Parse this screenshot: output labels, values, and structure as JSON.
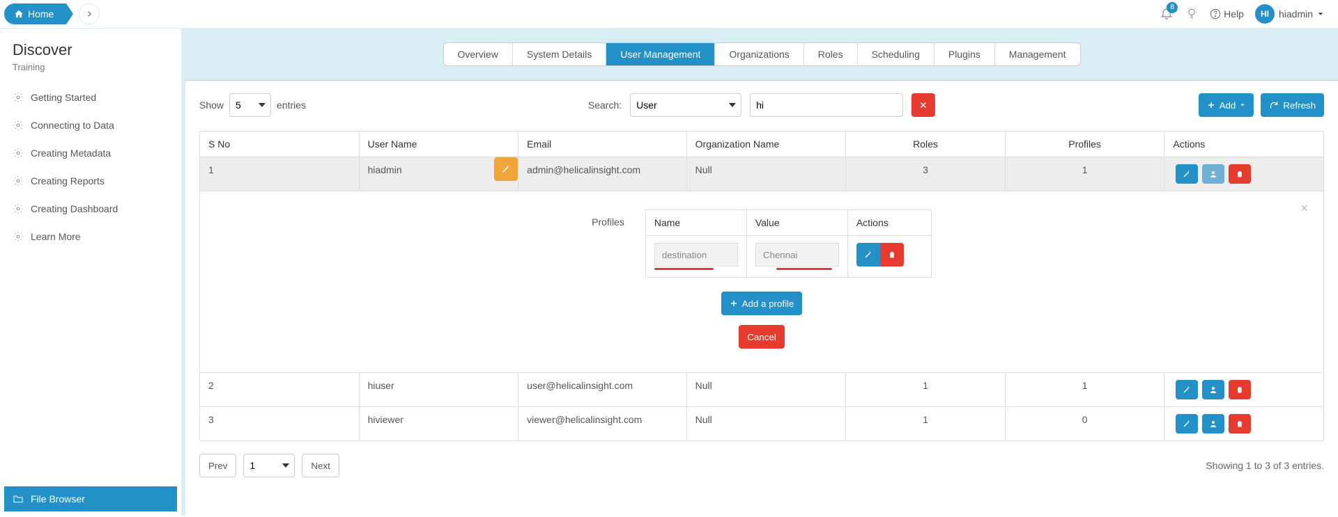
{
  "breadcrumb": {
    "home_label": "Home"
  },
  "topbar": {
    "notification_count": "8",
    "help_label": "Help",
    "user_initials": "HI",
    "user_name": "hiadmin"
  },
  "sidebar": {
    "title": "Discover",
    "subtitle": "Training",
    "items": [
      {
        "label": "Getting Started"
      },
      {
        "label": "Connecting to Data"
      },
      {
        "label": "Creating Metadata"
      },
      {
        "label": "Creating Reports"
      },
      {
        "label": "Creating Dashboard"
      },
      {
        "label": "Learn More"
      }
    ],
    "file_browser_label": "File Browser"
  },
  "tabs": [
    {
      "label": "Overview"
    },
    {
      "label": "System Details"
    },
    {
      "label": "User Management",
      "active": true
    },
    {
      "label": "Organizations"
    },
    {
      "label": "Roles"
    },
    {
      "label": "Scheduling"
    },
    {
      "label": "Plugins"
    },
    {
      "label": "Management"
    }
  ],
  "toolbar": {
    "show_label": "Show",
    "show_value": "5",
    "entries_label": "entries",
    "search_label": "Search:",
    "search_type": "User",
    "search_value": "hi",
    "add_label": "Add",
    "refresh_label": "Refresh"
  },
  "columns": {
    "sno": "S No",
    "username": "User Name",
    "email": "Email",
    "org": "Organization Name",
    "roles": "Roles",
    "profiles": "Profiles",
    "actions": "Actions"
  },
  "rows": [
    {
      "sno": "1",
      "username": "hiadmin",
      "email": "admin@helicalinsight.com",
      "org": "Null",
      "roles": "3",
      "profiles": "1",
      "expanded": true
    },
    {
      "sno": "2",
      "username": "hiuser",
      "email": "user@helicalinsight.com",
      "org": "Null",
      "roles": "1",
      "profiles": "1"
    },
    {
      "sno": "3",
      "username": "hiviewer",
      "email": "viewer@helicalinsight.com",
      "org": "Null",
      "roles": "1",
      "profiles": "0"
    }
  ],
  "profiles_panel": {
    "title": "Profiles",
    "name_header": "Name",
    "value_header": "Value",
    "actions_header": "Actions",
    "name_value": "destination",
    "value_value": "Chennai",
    "add_profile_label": "Add a profile",
    "cancel_label": "Cancel"
  },
  "pager": {
    "prev": "Prev",
    "page": "1",
    "next": "Next",
    "info": "Showing 1 to 3 of 3 entries."
  }
}
